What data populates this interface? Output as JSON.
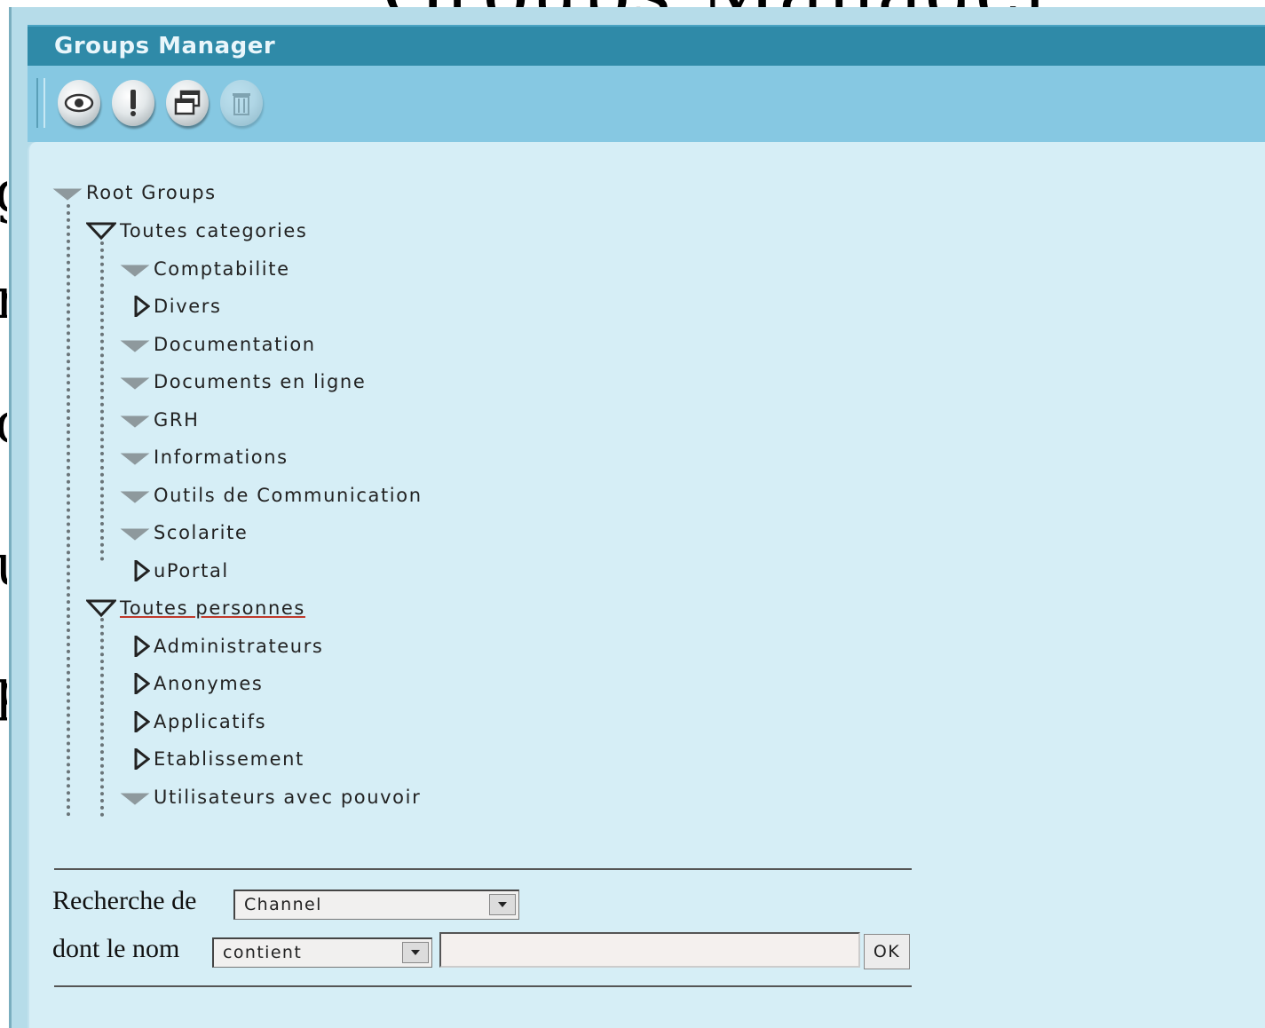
{
  "background": {
    "slide_title": "Groups Manager"
  },
  "window": {
    "title": "Groups Manager"
  },
  "toolbar": {
    "buttons": [
      {
        "icon": "eye-icon",
        "enabled": true
      },
      {
        "icon": "info-icon",
        "enabled": true
      },
      {
        "icon": "windows-icon",
        "enabled": true
      },
      {
        "icon": "trash-icon",
        "enabled": false
      }
    ]
  },
  "tree": {
    "root": "Root Groups",
    "nodes": [
      {
        "label": "Toutes categories",
        "state": "expanded"
      },
      {
        "label": "Comptabilite",
        "state": "empty"
      },
      {
        "label": "Divers",
        "state": "collapsed"
      },
      {
        "label": "Documentation",
        "state": "empty"
      },
      {
        "label": "Documents en ligne",
        "state": "empty"
      },
      {
        "label": "GRH",
        "state": "empty"
      },
      {
        "label": "Informations",
        "state": "empty"
      },
      {
        "label": "Outils de Communication",
        "state": "empty"
      },
      {
        "label": "Scolarite",
        "state": "empty"
      },
      {
        "label": "uPortal",
        "state": "collapsed"
      },
      {
        "label": "Toutes personnes",
        "state": "expanded"
      },
      {
        "label": "Administrateurs",
        "state": "collapsed"
      },
      {
        "label": "Anonymes",
        "state": "collapsed"
      },
      {
        "label": "Applicatifs",
        "state": "collapsed"
      },
      {
        "label": "Etablissement",
        "state": "collapsed"
      },
      {
        "label": "Utilisateurs avec pouvoir",
        "state": "empty"
      }
    ]
  },
  "search": {
    "label_type": "Recherche de",
    "type_value": "Channel",
    "label_name": "dont le nom",
    "operator_value": "contient",
    "query_value": "",
    "ok_label": "OK"
  },
  "colors": {
    "titlebar": "#2f8aa8",
    "toolbar": "#86c8e2",
    "content": "#d6eef6"
  }
}
